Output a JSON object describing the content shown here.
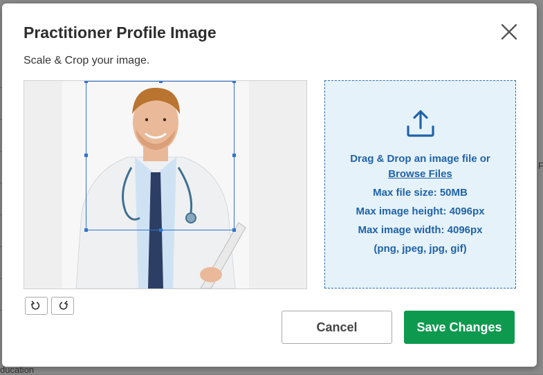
{
  "modal": {
    "title": "Practitioner Profile Image",
    "subtitle": "Scale & Crop your image."
  },
  "dropzone": {
    "drag_text": "Drag & Drop an image file",
    "or_text": "or",
    "browse_label": "Browse Files",
    "max_size": "Max file size: 50MB",
    "max_height": "Max image height: 4096px",
    "max_width": "Max image width: 4096px",
    "formats": "(png, jpeg, jpg, gif)"
  },
  "buttons": {
    "cancel_label": "Cancel",
    "save_label": "Save Changes"
  },
  "background": {
    "fragment_bottom": "ducation",
    "fragment_right": "F"
  },
  "colors": {
    "accent_blue": "#1f63a8",
    "save_green": "#0d9a4e",
    "crop_blue": "#2f74d0"
  },
  "icons": {
    "close": "close-icon",
    "upload": "upload-icon",
    "rotate_left": "rotate-left-icon",
    "rotate_right": "rotate-right-icon"
  }
}
